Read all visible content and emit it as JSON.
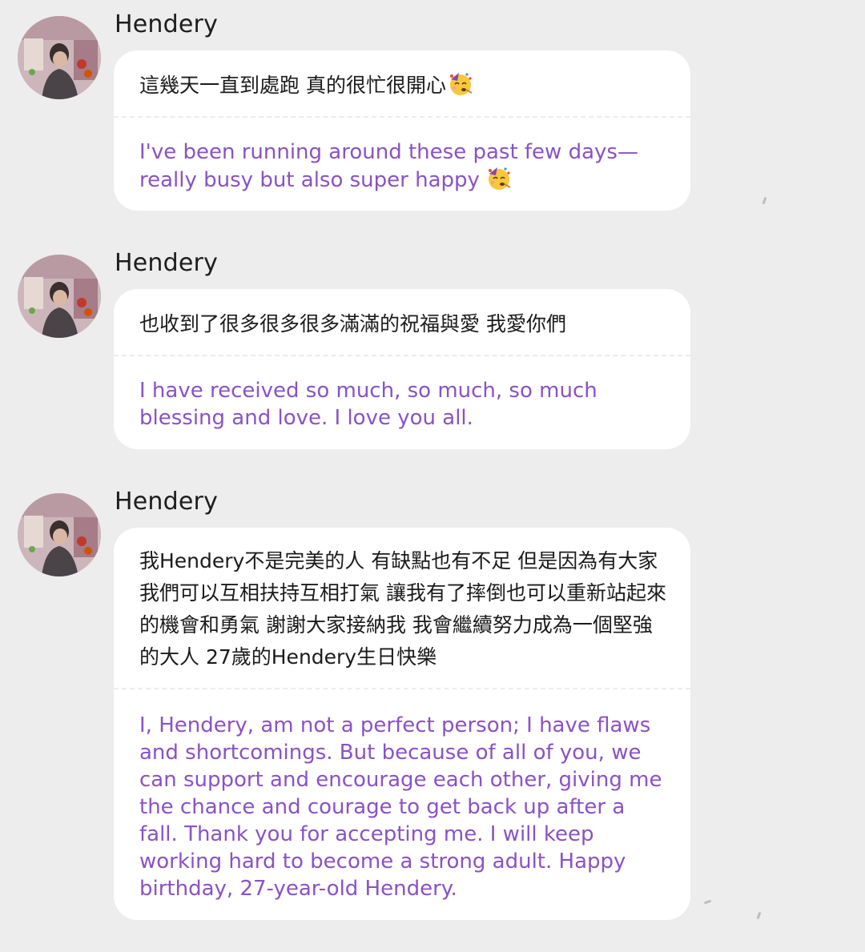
{
  "messages": [
    {
      "sender": "Hendery",
      "avatar_icon": "profile-photo-avatar",
      "original": "這幾天一直到處跑 真的很忙很開心",
      "original_emoji": "partying-face-emoji",
      "translation": "I've been running around these past few days—really busy but also super happy",
      "translation_emoji": "partying-face-emoji"
    },
    {
      "sender": "Hendery",
      "avatar_icon": "profile-photo-avatar",
      "original": "也收到了很多很多很多滿滿的祝福與愛 我愛你們",
      "translation": "I have received so much, so much, so much blessing and love. I love you all."
    },
    {
      "sender": "Hendery",
      "avatar_icon": "profile-photo-avatar",
      "original": "我Hendery不是完美的人 有缺點也有不足 但是因為有大家 我們可以互相扶持互相打氣 讓我有了摔倒也可以重新站起來的機會和勇氣 謝謝大家接納我 我會繼續努力成為一個堅強的大人 27歲的Hendery生日快樂",
      "translation": "I, Hendery, am not a perfect person; I have flaws and shortcomings. But because of all of you, we can support and encourage each other, giving me the chance and courage to get back up after a fall. Thank you for accepting me. I will keep working hard to become a strong adult. Happy birthday, 27-year-old Hendery."
    }
  ],
  "colors": {
    "background": "#ededed",
    "bubble": "#ffffff",
    "translation_text": "#8a52c4",
    "original_text": "#1b1b1b"
  }
}
